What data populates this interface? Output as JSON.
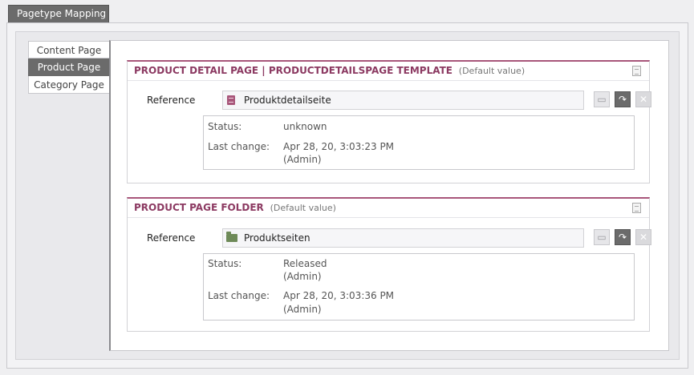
{
  "top_tab": {
    "label": "Pagetype Mapping"
  },
  "side_tabs": [
    {
      "label": "Content Page",
      "active": false
    },
    {
      "label": "Product Page",
      "active": true
    },
    {
      "label": "Category Page",
      "active": false
    }
  ],
  "sections": [
    {
      "title": "PRODUCT DETAIL PAGE | PRODUCTDETAILSPAGE TEMPLATE",
      "default_note": "(Default value)",
      "reference_label": "Reference",
      "reference_value": "Produktdetailseite",
      "reference_icon": "page-icon",
      "status_key": "Status:",
      "status_value": "unknown",
      "status_user": "",
      "last_change_key": "Last change:",
      "last_change_value": "Apr 28, 20, 3:03:23 PM",
      "last_change_user": "(Admin)"
    },
    {
      "title": "PRODUCT PAGE FOLDER",
      "default_note": "(Default value)",
      "reference_label": "Reference",
      "reference_value": "Produktseiten",
      "reference_icon": "folder-icon",
      "status_key": "Status:",
      "status_value": "Released",
      "status_user": "(Admin)",
      "last_change_key": "Last change:",
      "last_change_value": "Apr 28, 20, 3:03:36 PM",
      "last_change_user": "(Admin)"
    }
  ],
  "buttons": {
    "open_icon": "open-folder-icon",
    "select_icon": "select-reference-icon",
    "clear_icon": "clear-icon"
  },
  "colors": {
    "accent": "#8c3a62",
    "active_tab": "#6b6b6b",
    "folder": "#6e8a58"
  }
}
